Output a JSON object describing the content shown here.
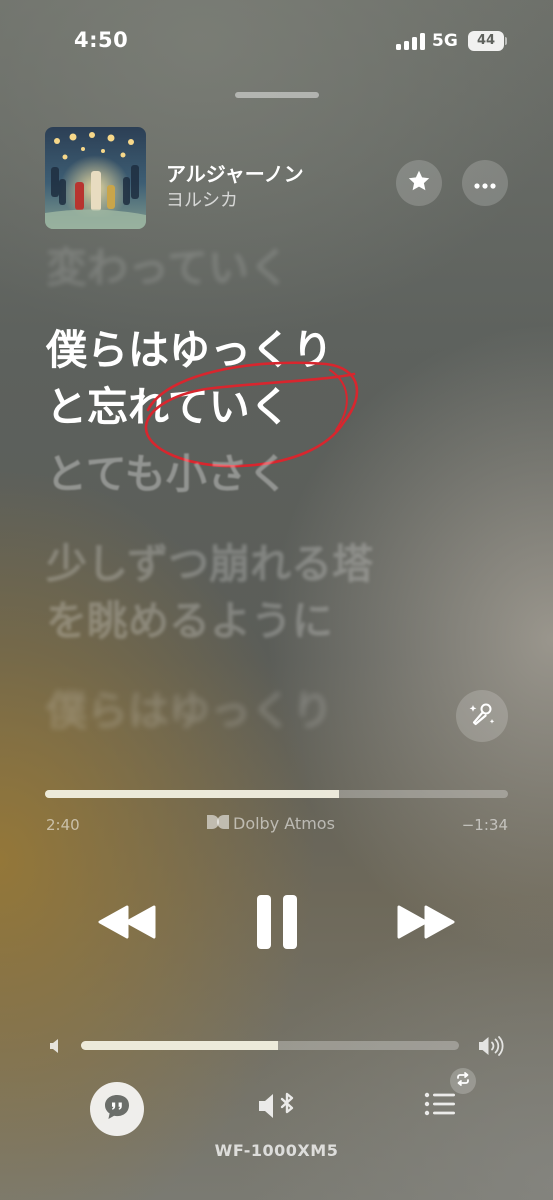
{
  "status_bar": {
    "time": "4:50",
    "network": "5G",
    "battery": "44"
  },
  "now_playing": {
    "title": "アルジャーノン",
    "artist": "ヨルシカ",
    "actions": {
      "star_icon": "star-icon",
      "more_icon": "ellipsis-icon"
    }
  },
  "lyrics": {
    "previous": "変わっていく",
    "active": [
      "僕らはゆっくり",
      "と忘れていく"
    ],
    "upcoming": [
      "とても小さく",
      "少しずつ崩れる塔",
      "を眺めるように",
      "僕らはゆっくり"
    ],
    "annotation_color": "#d8262e"
  },
  "playback": {
    "elapsed": "2:40",
    "remaining": "−1:34",
    "progress": 0.634,
    "dolby_label": "Dolby Atmos"
  },
  "volume": {
    "level": 0.52
  },
  "output": {
    "device": "WF-1000XM5"
  },
  "colors": {
    "accent_fill": "#f0eede",
    "track": "rgba(255,255,255,0.28)"
  }
}
